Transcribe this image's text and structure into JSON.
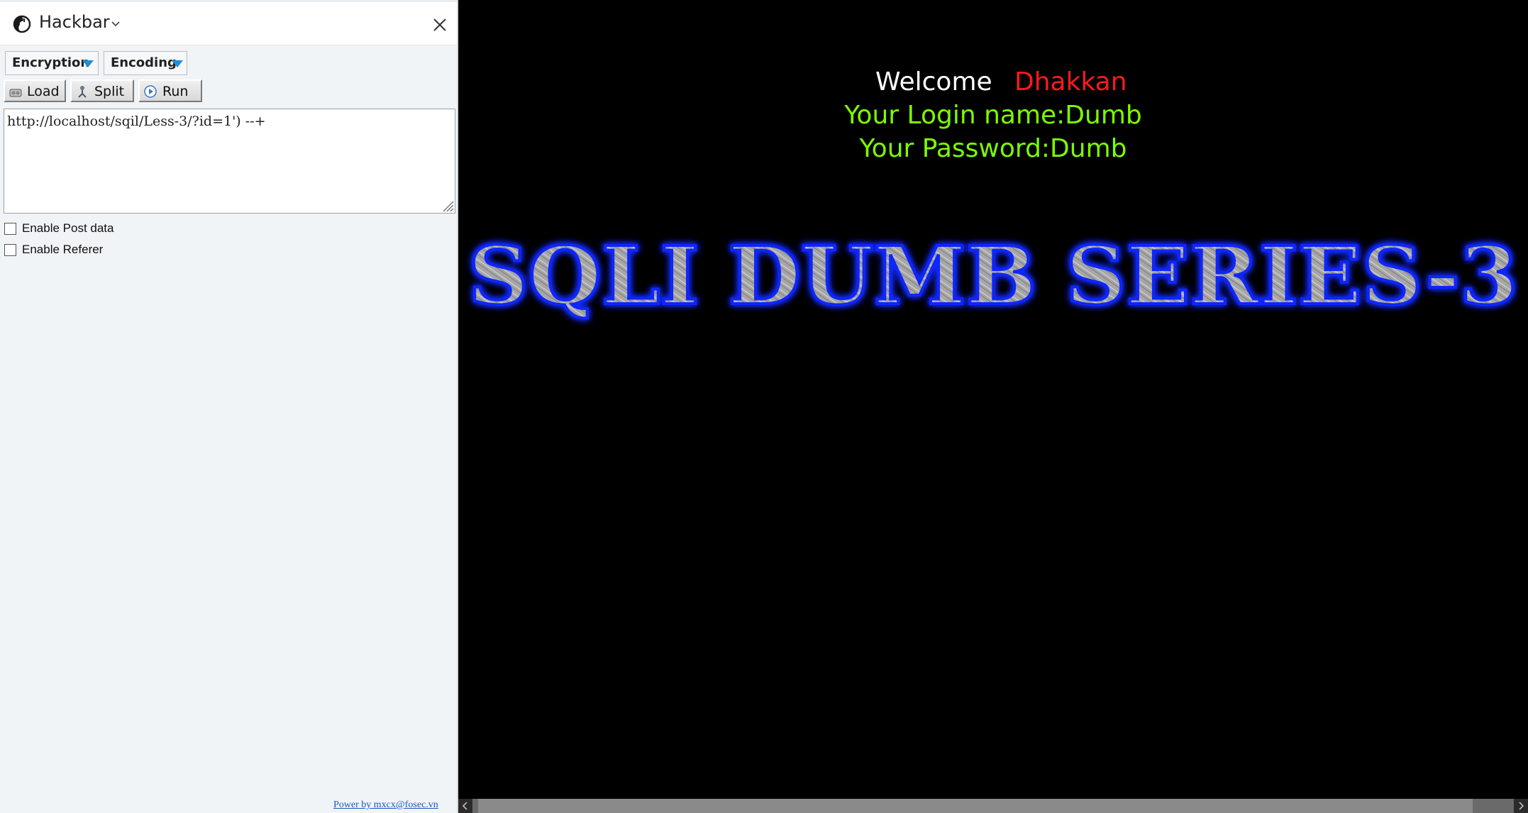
{
  "sidebar": {
    "title": "Hackbar",
    "encryption_label": "Encryption",
    "encoding_label": "Encoding",
    "load_label": "Load",
    "split_label": "Split",
    "run_label": "Run",
    "url_value": "http://localhost/sqil/Less-3/?id=1') --+",
    "enable_post_label": "Enable Post data",
    "enable_referer_label": "Enable Referer",
    "footer_link": "Power by mxcx@fosec.vn",
    "icons": {
      "logo": "firefox-logo-icon",
      "chevron": "chevron-down-icon",
      "close": "close-icon",
      "load": "load-icon",
      "split": "split-icon",
      "run": "run-icon"
    }
  },
  "main": {
    "welcome_label": "Welcome",
    "welcome_name": "Dhakkan",
    "login_line": "Your Login name:Dumb",
    "password_line": "Your Password:Dumb",
    "banner_text": "SQLI DUMB SERIES-3"
  },
  "colors": {
    "background": "#000000",
    "welcome": "#ffffff",
    "name": "#ff1a1a",
    "credentials": "#7cfc00",
    "banner_glow": "#1a2cff",
    "banner_fill": "#a9a9a9",
    "sidebar_bg": "#f1f4f6",
    "link": "#1a57c4"
  }
}
